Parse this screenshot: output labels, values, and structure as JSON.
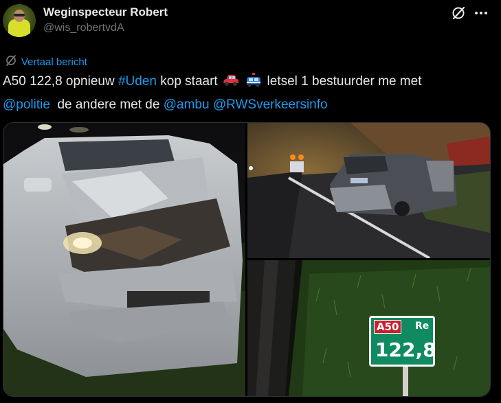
{
  "author": {
    "name": "Weginspecteur Robert",
    "handle": "@wis_robertvdA"
  },
  "header_icons": [
    "grok-icon",
    "more-icon"
  ],
  "translate_label": "Vertaal bericht",
  "tweet": {
    "line1_a": "A50 122,8 opnieuw ",
    "hashtag": "#Uden",
    "line1_b": " kop staart ",
    "line1_c": " letsel 1 bestuurder me met",
    "mention_politie": "@politie",
    "line2_a": "  de andere met de ",
    "mention_ambu": "@ambu",
    "mention_rws": "@RWSverkeersinfo",
    "emojis": [
      "red-car-icon",
      "police-car-icon"
    ]
  },
  "media": {
    "images": [
      "crashed-car-front-photo",
      "damaged-car-rear-highway-photo",
      "kilometer-marker-sign-photo"
    ],
    "sign": {
      "road": "A50",
      "direction": "Re",
      "hectometer": "122,8"
    }
  },
  "colors": {
    "link": "#1d9bf0",
    "text": "#e7e9ea",
    "muted": "#71767b",
    "background": "#000000"
  }
}
